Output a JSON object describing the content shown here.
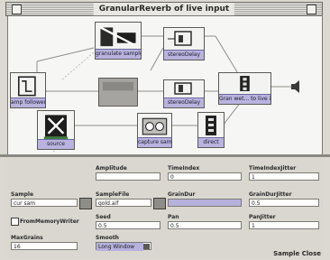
{
  "window": {
    "title": "GranularReverb of live input"
  },
  "nodes": [
    {
      "label": "granulate sample"
    },
    {
      "label": "stereoDelay"
    },
    {
      "label": "amp follower"
    },
    {
      "label": "stereoDelay"
    },
    {
      "label": "Gran wet... to live input"
    },
    {
      "label": "source"
    },
    {
      "label": "capture sample"
    },
    {
      "label": "direct"
    }
  ],
  "params": {
    "amplitude": {
      "label": "Amplitude",
      "value": ""
    },
    "time_index": {
      "label": "TimeIndex",
      "value": "0"
    },
    "time_index_jitter": {
      "label": "TimeIndexJitter",
      "value": "1"
    },
    "sample": {
      "label": "Sample",
      "value": "cur sam"
    },
    "sample_file": {
      "label": "SampleFile",
      "value": "gold.aif"
    },
    "grain_dur": {
      "label": "GrainDur",
      "value": ""
    },
    "grain_dur_jitter": {
      "label": "GrainDurJitter",
      "value": "0.5"
    },
    "from_memory": {
      "label": "FromMemoryWriter"
    },
    "seed": {
      "label": "Seed",
      "value": "0.5"
    },
    "pan": {
      "label": "Pan",
      "value": "0.5"
    },
    "pan_jitter": {
      "label": "PanJitter",
      "value": "1"
    },
    "max_grains": {
      "label": "MaxGrains",
      "value": "16"
    },
    "smooth": {
      "label": "Smooth",
      "value": "Long Window"
    }
  },
  "footer": {
    "sample_close": "Sample Close"
  },
  "colors": {
    "accent_purple": "#b7b1de",
    "canvas": "#f6f6f4",
    "chrome": "#dcd9d2"
  }
}
